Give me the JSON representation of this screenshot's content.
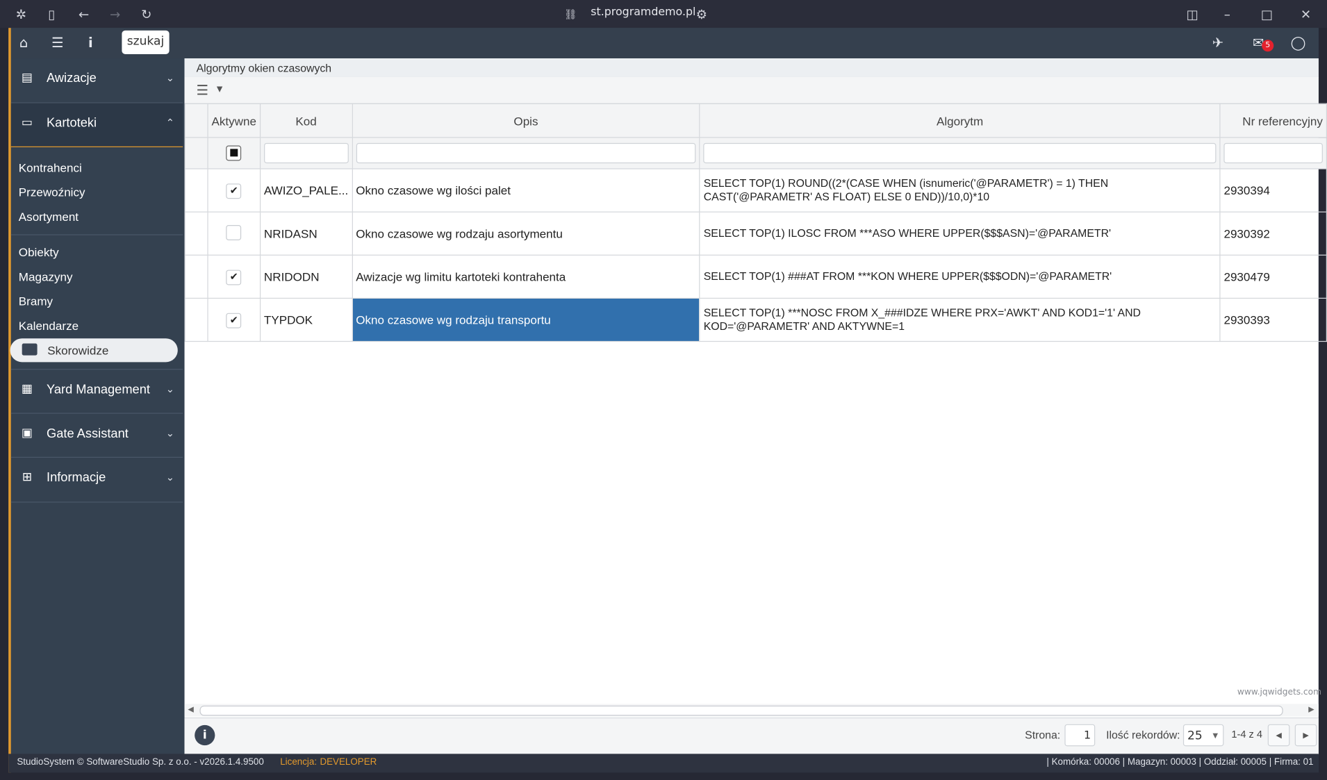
{
  "browser": {
    "url": "st.programdemo.pl"
  },
  "topbar": {
    "search_label": "szukaj",
    "mail_count": "5"
  },
  "sidebar": {
    "sections": [
      {
        "label": "Awizacje"
      },
      {
        "label": "Kartoteki"
      },
      {
        "label": "Yard Management"
      },
      {
        "label": "Gate Assistant"
      },
      {
        "label": "Informacje"
      }
    ],
    "kartoteki_items": [
      "Kontrahenci",
      "Przewoźnicy",
      "Asortyment",
      "Obiekty",
      "Magazyny",
      "Bramy",
      "Kalendarze",
      "Skorowidze"
    ]
  },
  "page": {
    "title": "Algorytmy okien czasowych"
  },
  "grid": {
    "columns": [
      "Aktywne",
      "Kod",
      "Opis",
      "Algorytm",
      "Nr referencyjny"
    ],
    "rows": [
      {
        "active": true,
        "code": "AWIZO_PALE...",
        "desc": "Okno czasowe wg ilości palet",
        "algo": "SELECT TOP(1) ROUND((2*(CASE WHEN (isnumeric('@PARAMETR') = 1) THEN CAST('@PARAMETR' AS FLOAT) ELSE 0 END))/10,0)*10",
        "ref": "2930394"
      },
      {
        "active": false,
        "code": "NRIDASN",
        "desc": "Okno czasowe wg rodzaju asortymentu",
        "algo": "SELECT TOP(1) ILOSC FROM ***ASO WHERE UPPER($$$ASN)='@PARAMETR'",
        "ref": "2930392"
      },
      {
        "active": true,
        "code": "NRIDODN",
        "desc": "Awizacje wg limitu kartoteki kontrahenta",
        "algo": "SELECT TOP(1) ###AT FROM ***KON WHERE UPPER($$$ODN)='@PARAMETR'",
        "ref": "2930479"
      },
      {
        "active": true,
        "code": "TYPDOK",
        "desc": "Okno czasowe wg rodzaju transportu",
        "algo": "SELECT TOP(1) ***NOSC FROM X_###IDZE WHERE PRX='AWKT' AND KOD1='1' AND KOD='@PARAMETR' AND AKTYWNE=1",
        "ref": "2930393"
      }
    ],
    "watermark": "www.jqwidgets.com"
  },
  "pager": {
    "page_label": "Strona:",
    "page_value": "1",
    "records_label": "Ilość rekordów:",
    "records_value": "25",
    "range": "1-4 z 4"
  },
  "status": {
    "copyright": "StudioSystem © SoftwareStudio Sp. z o.o. - v2026.1.4.9500",
    "license_label": "Licencja:",
    "license_value": "DEVELOPER",
    "right": "| Komórka: 00006 | Magazyn: 00003 | Oddział: 00005 | Firma: 01"
  },
  "colors": {
    "accent": "#e39a2d",
    "selection": "#3170ad",
    "sidebar": "#344150",
    "badge": "#e4222d"
  }
}
